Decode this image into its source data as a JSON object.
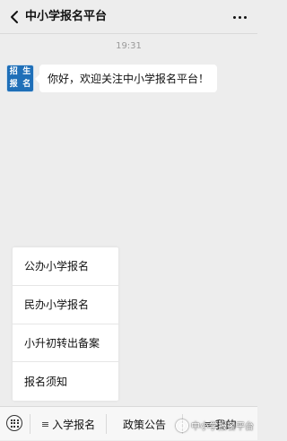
{
  "header": {
    "back_icon": "back-arrow-icon",
    "title": "中小学报名平台",
    "more_icon": "more-dots-icon"
  },
  "chat": {
    "time": "19:31",
    "avatar_text": [
      "招",
      "生",
      "报",
      "名"
    ],
    "message": "你好，欢迎关注中小学报名平台！"
  },
  "popup_menu": {
    "items": [
      {
        "label": "公办小学报名"
      },
      {
        "label": "民办小学报名"
      },
      {
        "label": "小升初转出备案"
      },
      {
        "label": "报名须知"
      }
    ]
  },
  "bottom_menu": {
    "keyboard_icon": "keyboard-icon",
    "items": [
      {
        "label": "入学报名",
        "lines": "≡"
      },
      {
        "label": "政策公告"
      },
      {
        "label": "我的",
        "lines": "≡"
      }
    ]
  },
  "watermark": {
    "text": "中小学报名平台"
  },
  "colors": {
    "background": "#ededed",
    "avatar_blue": "#1f6fb8",
    "bubble": "#ffffff"
  }
}
